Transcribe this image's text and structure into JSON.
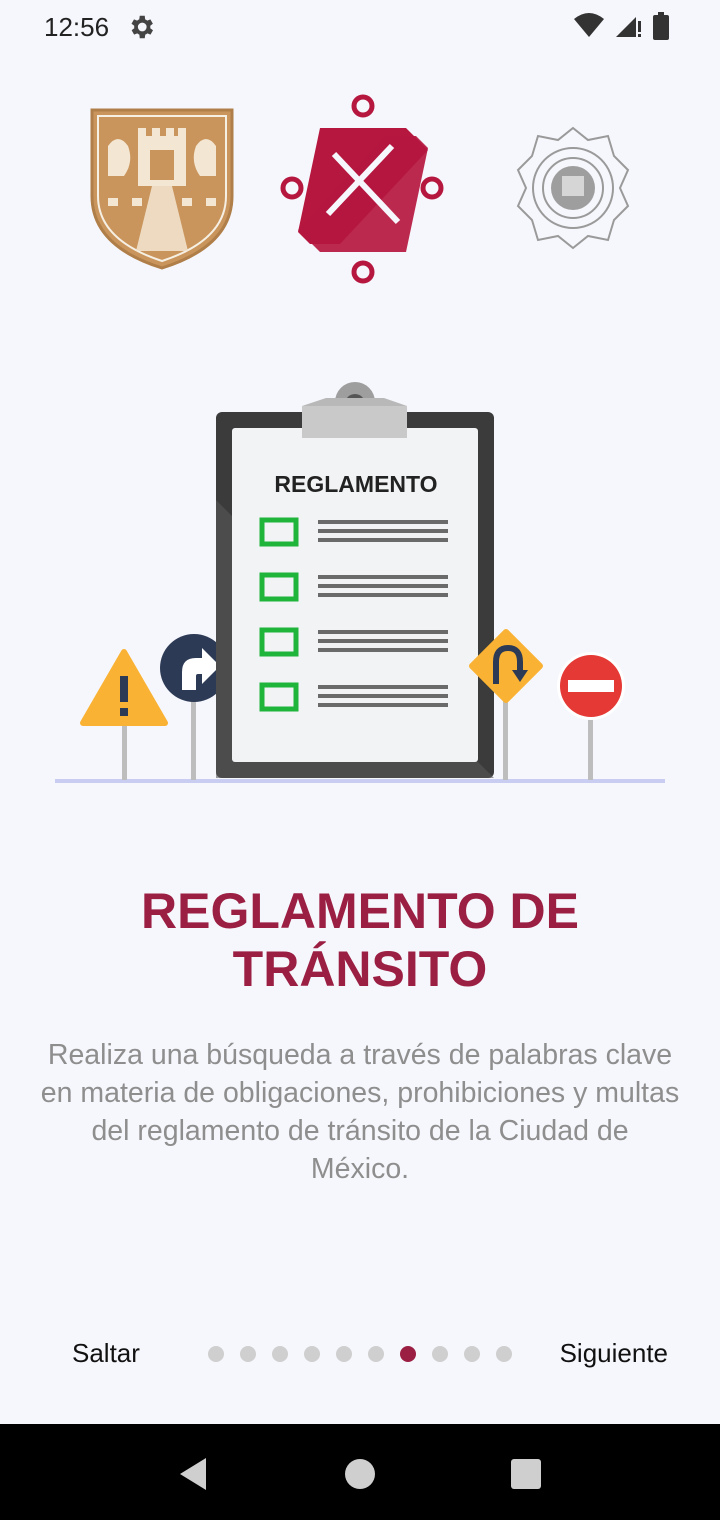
{
  "status_bar": {
    "time": "12:56",
    "left_icon": "gear-icon",
    "right_icons": [
      "wifi-icon",
      "signal-icon",
      "battery-icon"
    ]
  },
  "logos": [
    "cdmx-coat-of-arms-logo",
    "gobierno-cdmx-logo",
    "seguridad-ciudadana-badge-logo"
  ],
  "illustration": {
    "clipboard_heading": "REGLAMENTO",
    "checklist_rows": 4,
    "signs": [
      "warning-sign-icon",
      "turn-right-sign-icon",
      "u-turn-sign-icon",
      "no-entry-sign-icon"
    ]
  },
  "content": {
    "title_line1": "REGLAMENTO DE",
    "title_line2": "TRÁNSITO",
    "description": "Realiza una búsqueda a través de palabras clave en materia de obligaciones, prohibiciones y multas del reglamento de tránsito de la Ciudad de México."
  },
  "navigation": {
    "skip_label": "Saltar",
    "next_label": "Siguiente",
    "page_count": 10,
    "current_page": 7
  },
  "colors": {
    "primary": "#9b1f43",
    "coat_gold": "#c9955c",
    "checkbox_green": "#1fb53b",
    "warning_yellow": "#f9b233",
    "sign_navy": "#2d3a55",
    "stop_red": "#e53935",
    "background": "#f6f7fc"
  },
  "android_nav": [
    "back-icon",
    "home-icon",
    "recents-icon"
  ]
}
